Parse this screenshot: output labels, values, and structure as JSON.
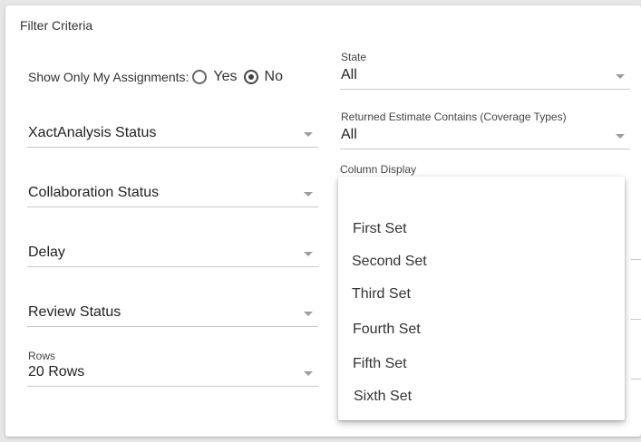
{
  "panel": {
    "title": "Filter Criteria"
  },
  "assignments": {
    "label": "Show Only My Assignments:",
    "options": [
      {
        "label": "Yes",
        "checked": false
      },
      {
        "label": "No",
        "checked": true
      }
    ]
  },
  "state": {
    "label": "State",
    "value": "All"
  },
  "returned_estimate": {
    "label": "Returned Estimate Contains (Coverage Types)",
    "value": "All"
  },
  "xact_status": {
    "value": "XactAnalysis Status"
  },
  "collab_status": {
    "value": "Collaboration Status"
  },
  "delay": {
    "value": "Delay"
  },
  "review_status": {
    "value": "Review Status"
  },
  "rows": {
    "label": "Rows",
    "value": "20 Rows"
  },
  "column_display": {
    "label": "Column Display",
    "options": [
      "First Set",
      "Second Set",
      "Third Set",
      "Fourth Set",
      "Fifth Set",
      "Sixth Set"
    ]
  },
  "icons": {
    "dropdown_arrow": "chevron-down-icon"
  }
}
